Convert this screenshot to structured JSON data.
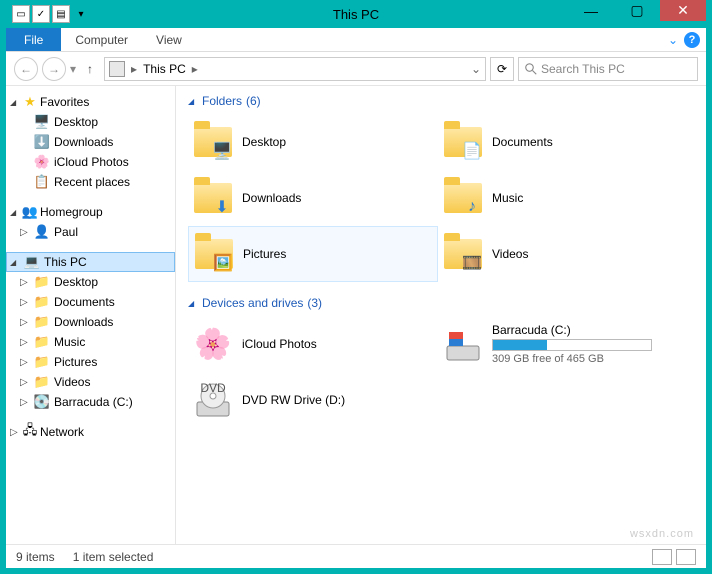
{
  "window": {
    "title": "This PC"
  },
  "ribbon": {
    "file": "File",
    "tabs": [
      "Computer",
      "View"
    ]
  },
  "nav": {
    "crumb": "This PC",
    "search_placeholder": "Search This PC"
  },
  "sidebar": {
    "favorites": {
      "label": "Favorites",
      "items": [
        "Desktop",
        "Downloads",
        "iCloud Photos",
        "Recent places"
      ]
    },
    "homegroup": {
      "label": "Homegroup",
      "items": [
        "Paul"
      ]
    },
    "thispc": {
      "label": "This PC",
      "items": [
        "Desktop",
        "Documents",
        "Downloads",
        "Music",
        "Pictures",
        "Videos",
        "Barracuda (C:)"
      ]
    },
    "network": {
      "label": "Network"
    }
  },
  "groups": {
    "folders": {
      "label": "Folders",
      "count": "(6)",
      "items": [
        "Desktop",
        "Documents",
        "Downloads",
        "Music",
        "Pictures",
        "Videos"
      ]
    },
    "drives": {
      "label": "Devices and drives",
      "count": "(3)",
      "items": [
        {
          "name": "iCloud Photos"
        },
        {
          "name": "Barracuda (C:)",
          "free": "309 GB free of 465 GB",
          "pct": 34
        },
        {
          "name": "DVD RW Drive (D:)"
        }
      ]
    }
  },
  "status": {
    "items": "9 items",
    "selected": "1 item selected"
  },
  "watermark": "wsxdn.com"
}
